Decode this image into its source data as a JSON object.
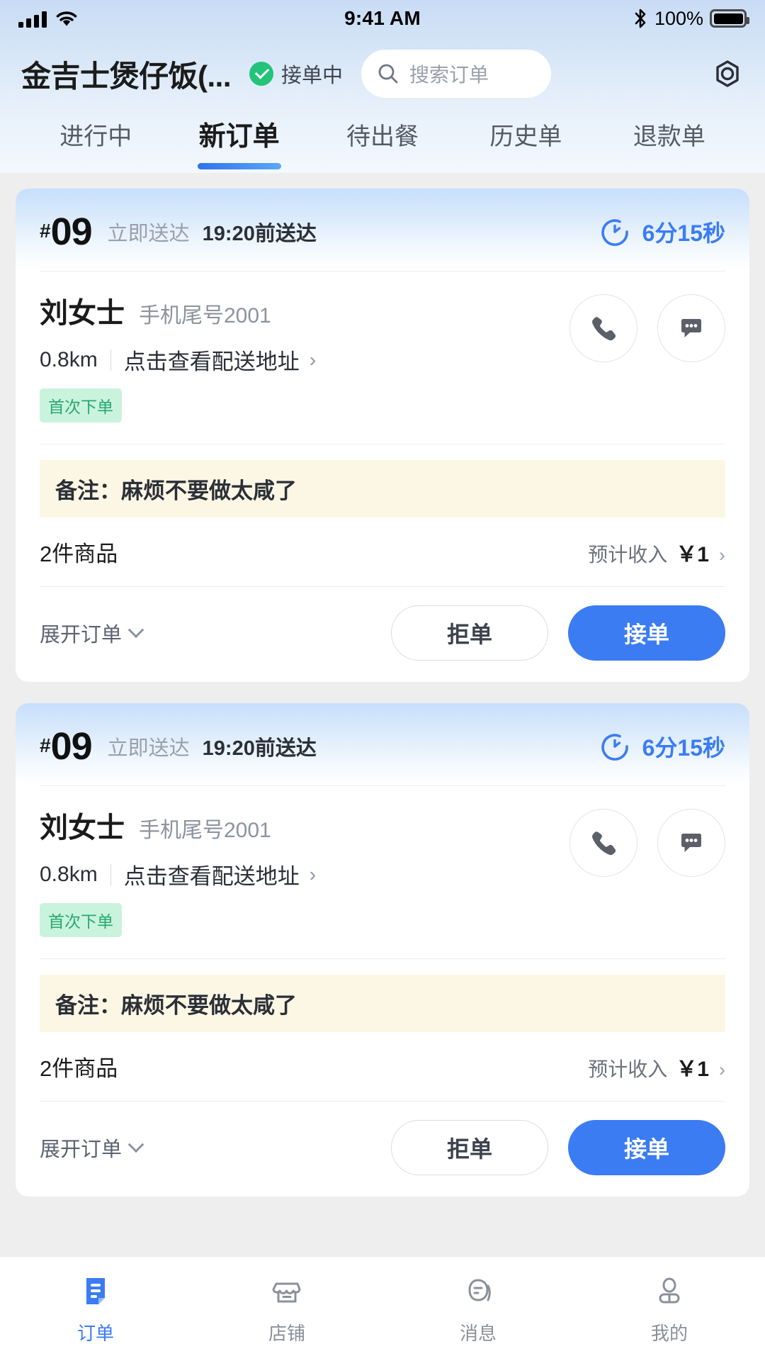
{
  "status_bar": {
    "time": "9:41 AM",
    "battery_percent": "100%",
    "signal_icon": "cellular-signal-icon",
    "wifi_icon": "wifi-icon",
    "bluetooth_icon": "bluetooth-icon",
    "battery_icon": "battery-full-icon"
  },
  "app_bar": {
    "shop_name": "金吉士煲仔饭(...",
    "shop_status": "接单中",
    "status_icon": "check-circle-icon",
    "search_placeholder": "搜索订单",
    "search_value": "",
    "search_icon": "search-icon",
    "scan_icon": "hex-nut-icon"
  },
  "tabs": [
    {
      "label": "进行中",
      "active": false
    },
    {
      "label": "新订单",
      "active": true
    },
    {
      "label": "待出餐",
      "active": false
    },
    {
      "label": "历史单",
      "active": false
    },
    {
      "label": "退款单",
      "active": false
    }
  ],
  "orders": [
    {
      "hash": "#",
      "number": "09",
      "delivery_type": "立即送达",
      "deliver_by": "19:20前送达",
      "countdown": "6分15秒",
      "countdown_icon": "timer-icon",
      "customer_name": "刘女士",
      "phone_tail": "手机尾号2001",
      "distance": "0.8km",
      "address_link": "点击查看配送地址",
      "address_arrow": "›",
      "tag": "首次下单",
      "call_icon": "phone-icon",
      "message_icon": "message-bubble-icon",
      "remark": "备注：麻烦不要做太咸了",
      "item_count": "2件商品",
      "income_label": "预计收入",
      "income_amount": "￥1",
      "income_arrow": "›",
      "expand_label": "展开订单",
      "reject_label": "拒单",
      "accept_label": "接单"
    },
    {
      "hash": "#",
      "number": "09",
      "delivery_type": "立即送达",
      "deliver_by": "19:20前送达",
      "countdown": "6分15秒",
      "countdown_icon": "timer-icon",
      "customer_name": "刘女士",
      "phone_tail": "手机尾号2001",
      "distance": "0.8km",
      "address_link": "点击查看配送地址",
      "address_arrow": "›",
      "tag": "首次下单",
      "call_icon": "phone-icon",
      "message_icon": "message-bubble-icon",
      "remark": "备注：麻烦不要做太咸了",
      "item_count": "2件商品",
      "income_label": "预计收入",
      "income_amount": "￥1",
      "income_arrow": "›",
      "expand_label": "展开订单",
      "reject_label": "拒单",
      "accept_label": "接单"
    }
  ],
  "bottom_nav": [
    {
      "label": "订单",
      "icon": "order-list-icon",
      "active": true
    },
    {
      "label": "店铺",
      "icon": "shop-icon",
      "active": false
    },
    {
      "label": "消息",
      "icon": "message-icon",
      "active": false
    },
    {
      "label": "我的",
      "icon": "user-icon",
      "active": false
    }
  ],
  "colors": {
    "accent_blue": "#3b7cf3",
    "status_green": "#23c37a",
    "tag_green_bg": "#caf3dd",
    "tag_green_text": "#27a96f",
    "remark_bg": "#fcf6e5",
    "page_bg": "#eeeeee"
  }
}
